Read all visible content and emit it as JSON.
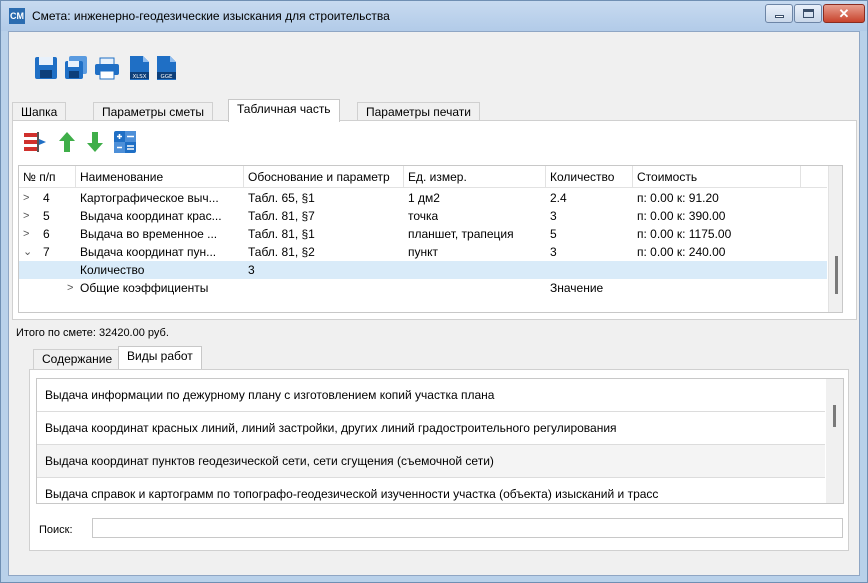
{
  "window": {
    "app_icon_text": "CM",
    "title": "Смета: инженерно-геодезические изыскания для строительства",
    "close_glyph": "✕"
  },
  "toolbar": {
    "icons": [
      "save-icon",
      "save-all-icon",
      "print-icon",
      "export-xlsx-icon",
      "export-gge-icon"
    ],
    "xlsx_badge": "XLSX",
    "gge_badge": "GGE"
  },
  "tabs": [
    {
      "label": "Шапка"
    },
    {
      "label": "Параметры сметы"
    },
    {
      "label": "Табличная часть"
    },
    {
      "label": "Параметры печати"
    }
  ],
  "active_tab": "Табличная часть",
  "table_toolbar": {
    "icons": [
      "insert-row-icon",
      "move-up-icon",
      "move-down-icon",
      "calculator-icon"
    ]
  },
  "grid": {
    "columns": [
      "№ п/п",
      "Наименование",
      "Обоснование и параметр",
      "Ед. измер.",
      "Количество",
      "Стоимость"
    ],
    "rows": [
      {
        "expander": ">",
        "num": "4",
        "name": "Картографическое выч...",
        "basis": "Табл. 65, §1",
        "unit": "1 дм2",
        "qty": "2.4",
        "cost": "п: 0.00 к: 91.20"
      },
      {
        "expander": ">",
        "num": "5",
        "name": "Выдача координат крас...",
        "basis": "Табл. 81, §7",
        "unit": "точка",
        "qty": "3",
        "cost": "п: 0.00 к: 390.00"
      },
      {
        "expander": ">",
        "num": "6",
        "name": "Выдача во временное ...",
        "basis": "Табл. 81, §1",
        "unit": "планшет, трапеция",
        "qty": "5",
        "cost": "п: 0.00 к: 1175.00"
      },
      {
        "expander": "⌄",
        "num": "7",
        "name": "Выдача координат пун...",
        "basis": "Табл. 81, §2",
        "unit": "пункт",
        "qty": "3",
        "cost": "п: 0.00 к: 240.00"
      }
    ],
    "sub_quantity": {
      "label": "Количество",
      "value": "3"
    },
    "sub_coeffs": {
      "expander": ">",
      "label": "Общие коэффициенты",
      "value_header": "Значение"
    }
  },
  "total": "Итого по смете:  32420.00 руб.",
  "bottom_tabs": [
    {
      "label": "Содержание"
    },
    {
      "label": "Виды работ"
    }
  ],
  "active_bottom_tab": "Виды работ",
  "work_types": [
    "Выдача информации по дежурному плану с изготовлением копий участка плана",
    "Выдача координат красных линий, линий застройки, других линий градостроительного регулирования",
    "Выдача координат пунктов геодезической сети, сети сгущения (съемочной сети)",
    "Выдача справок и картограмм по топографо-геодезической изученности участка (объекта) изысканий и трасс"
  ],
  "search": {
    "label": "Поиск:",
    "value": ""
  },
  "colors": {
    "title_bar": "#b9d1ea",
    "selection": "#d9ebf9",
    "accent_blue": "#1f6fc5",
    "green_arrow": "#3fae49"
  }
}
